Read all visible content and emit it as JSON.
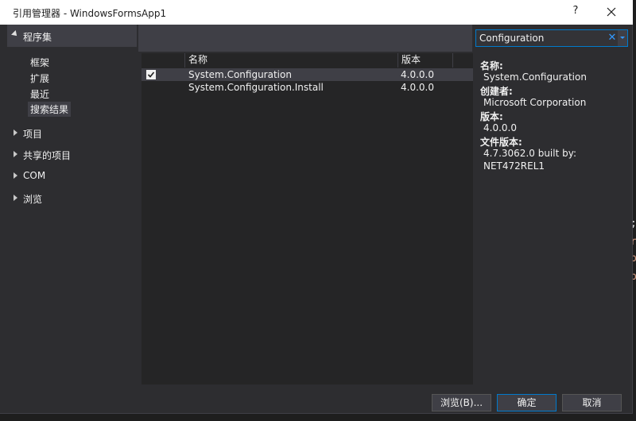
{
  "window": {
    "title": "引用管理器 - WindowsFormsApp1",
    "help_label": "?"
  },
  "nav": {
    "header": "程序集",
    "sub_items": [
      "框架",
      "扩展",
      "最近",
      "搜索结果"
    ],
    "groups": [
      "项目",
      "共享的项目",
      "COM",
      "浏览"
    ]
  },
  "search": {
    "value": "Configuration"
  },
  "list": {
    "columns": [
      "名称",
      "版本"
    ],
    "rows": [
      {
        "checked": true,
        "name": "System.Configuration",
        "version": "4.0.0.0"
      },
      {
        "checked": false,
        "name": "System.Configuration.Install",
        "version": "4.0.0.0"
      }
    ]
  },
  "details": {
    "name_label": "名称:",
    "name_value": "System.Configuration",
    "creator_label": "创建者:",
    "creator_value": "Microsoft Corporation",
    "version_label": "版本:",
    "version_value": "4.0.0.0",
    "file_version_label": "文件版本:",
    "file_version_line1": "4.7.3062.0 built by:",
    "file_version_line2": "NET472REL1"
  },
  "buttons": {
    "browse": "浏览(B)...",
    "ok": "确定",
    "cancel": "取消"
  },
  "colors": {
    "accent": "#007acc",
    "dialog_bg": "#2d2d30",
    "list_bg": "#252526",
    "selected": "#3f3f46"
  }
}
